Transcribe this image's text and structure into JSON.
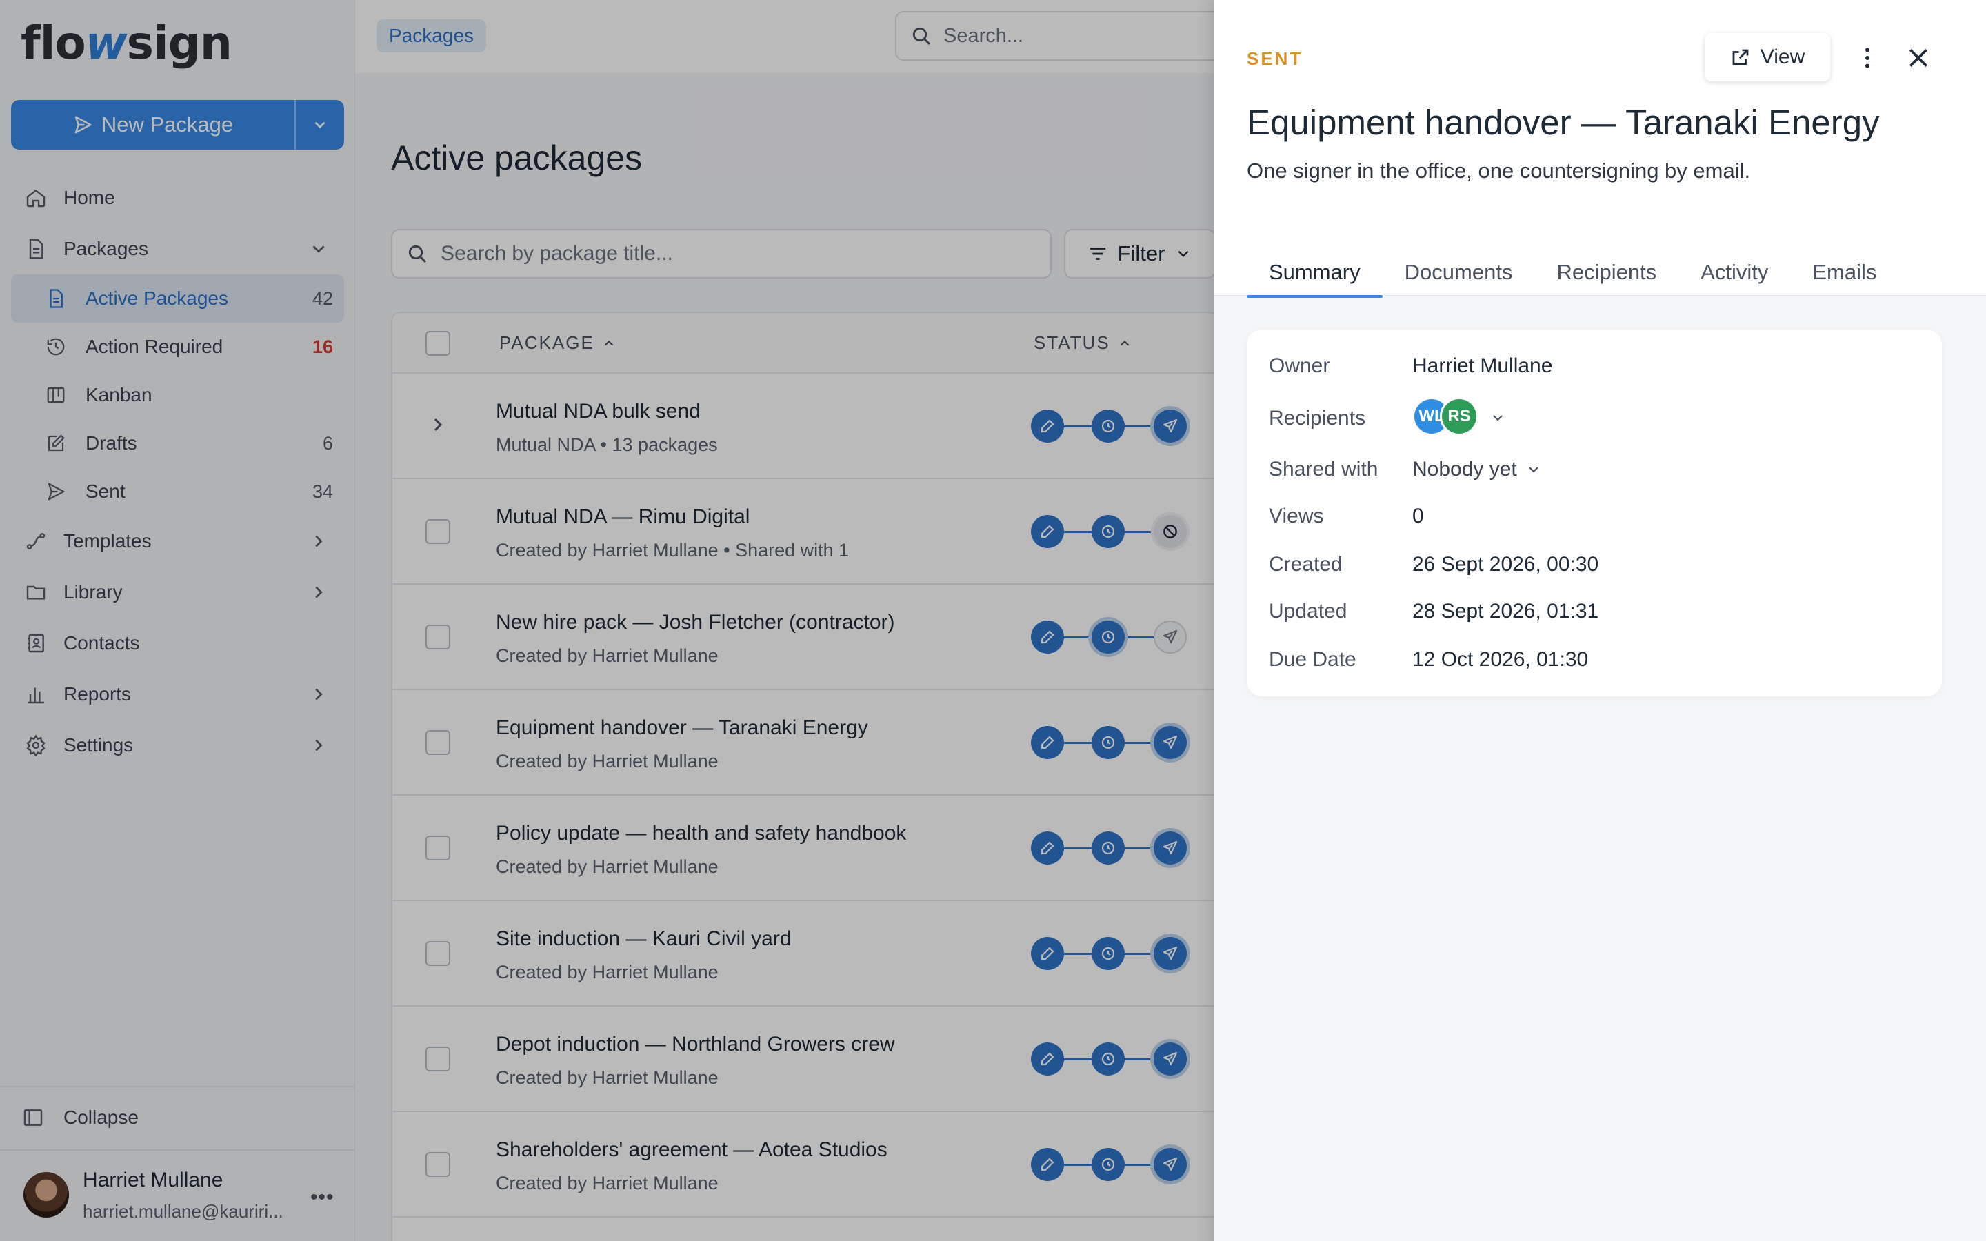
{
  "app": {
    "logo_left": "flo",
    "logo_mid": "w",
    "logo_right": "sign"
  },
  "colors": {
    "accent": "#3a8ae6",
    "status_sent": "#d99227",
    "badge_red": "#d63a2f"
  },
  "new_package": {
    "label": "New Package"
  },
  "nav": {
    "home": "Home",
    "packages": "Packages",
    "sub": [
      {
        "label": "Active Packages",
        "count": "42"
      },
      {
        "label": "Action Required",
        "count": "16"
      },
      {
        "label": "Kanban",
        "count": ""
      },
      {
        "label": "Drafts",
        "count": "6"
      },
      {
        "label": "Sent",
        "count": "34"
      }
    ],
    "templates": "Templates",
    "library": "Library",
    "contacts": "Contacts",
    "reports": "Reports",
    "settings": "Settings",
    "collapse": "Collapse"
  },
  "user": {
    "name": "Harriet Mullane",
    "email": "harriet.mullane@kauriri..."
  },
  "topbar": {
    "breadcrumb": "Packages",
    "search_placeholder": "Search..."
  },
  "page": {
    "title": "Active packages",
    "search_placeholder": "Search by package title...",
    "filter_label": "Filter"
  },
  "table": {
    "col_package": "PACKAGE",
    "col_status": "STATUS",
    "rows": [
      {
        "title": "Mutual NDA bulk send",
        "subtitle": "Mutual NDA • 13 packages"
      },
      {
        "title": "Mutual NDA — Rimu Digital",
        "subtitle": "Created by Harriet Mullane • Shared with 1"
      },
      {
        "title": "New hire pack — Josh Fletcher (contractor)",
        "subtitle": "Created by Harriet Mullane"
      },
      {
        "title": "Equipment handover — Taranaki Energy",
        "subtitle": "Created by Harriet Mullane"
      },
      {
        "title": "Policy update — health and safety handbook",
        "subtitle": "Created by Harriet Mullane"
      },
      {
        "title": "Site induction — Kauri Civil yard",
        "subtitle": "Created by Harriet Mullane"
      },
      {
        "title": "Depot induction — Northland Growers crew",
        "subtitle": "Created by Harriet Mullane"
      },
      {
        "title": "Shareholders' agreement — Aotea Studios",
        "subtitle": "Created by Harriet Mullane"
      }
    ]
  },
  "drawer": {
    "status": "SENT",
    "view_label": "View",
    "title": "Equipment handover — Taranaki Energy",
    "description": "One signer in the office, one countersigning by email.",
    "tabs": [
      "Summary",
      "Documents",
      "Recipients",
      "Activity",
      "Emails"
    ],
    "summary": {
      "owner_label": "Owner",
      "owner": "Harriet Mullane",
      "recipients_label": "Recipients",
      "recipient_initials": [
        "WL",
        "RS"
      ],
      "shared_label": "Shared with",
      "shared": "Nobody yet",
      "views_label": "Views",
      "views": "0",
      "created_label": "Created",
      "created": "26 Sept 2026, 00:30",
      "updated_label": "Updated",
      "updated": "28 Sept 2026, 01:31",
      "due_label": "Due Date",
      "due": "12 Oct 2026, 01:30"
    }
  }
}
